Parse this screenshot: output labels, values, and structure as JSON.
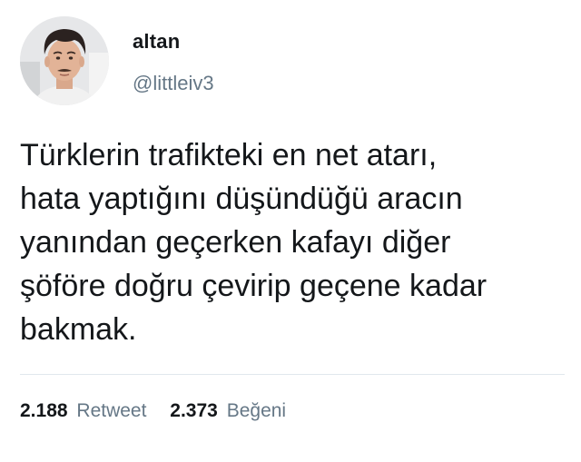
{
  "user": {
    "name": "altan",
    "handle": "@littleiv3",
    "avatar": "profile-photo"
  },
  "tweet": {
    "lines": [
      "Türklerin trafikteki en net atarı,",
      "hata yaptığını düşündüğü aracın",
      "yanından geçerken kafayı diğer",
      "şöföre doğru çevirip geçene kadar",
      "bakmak."
    ]
  },
  "stats": {
    "retweets": {
      "count": "2.188",
      "label": "Retweet"
    },
    "likes": {
      "count": "2.373",
      "label": "Beğeni"
    }
  },
  "colors": {
    "text": "#14171a",
    "secondary": "#657786",
    "divider": "#e1e8ed"
  }
}
